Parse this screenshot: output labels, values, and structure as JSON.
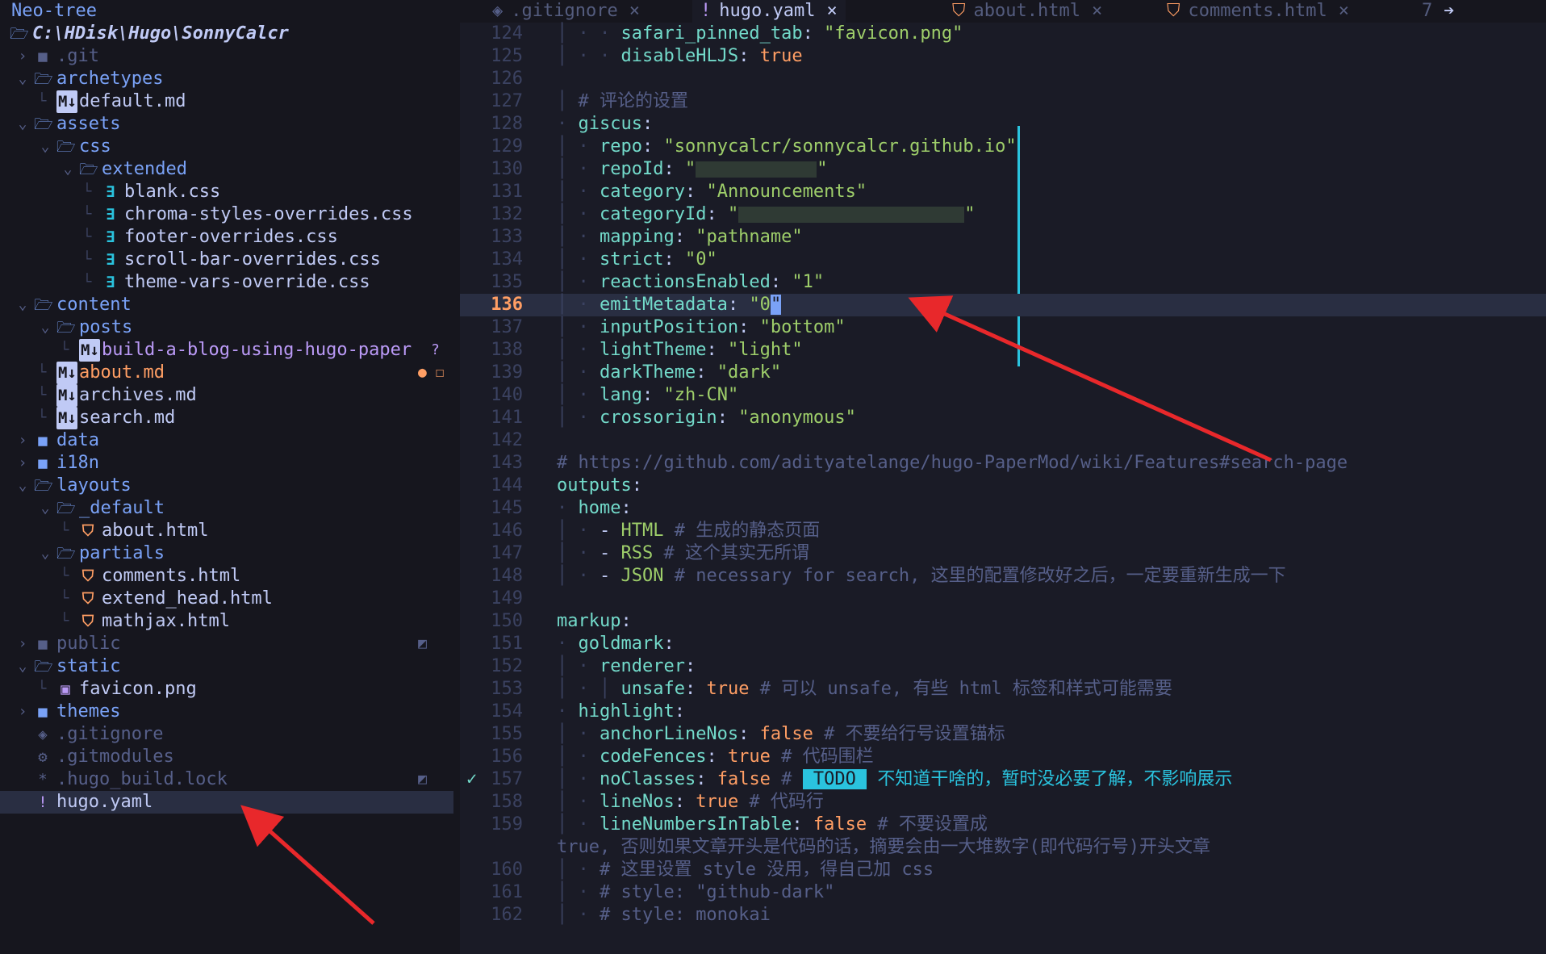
{
  "sidebar": {
    "title": "Neo-tree",
    "root": "C:\\HDisk\\Hugo\\SonnyCalcr",
    "items": [
      {
        "name": ".git",
        "kind": "dir-dim",
        "depth": 0,
        "open": false
      },
      {
        "name": "archetypes",
        "kind": "dir",
        "depth": 0,
        "open": true
      },
      {
        "name": "default.md",
        "kind": "md",
        "depth": 1
      },
      {
        "name": "assets",
        "kind": "dir",
        "depth": 0,
        "open": true
      },
      {
        "name": "css",
        "kind": "dir",
        "depth": 1,
        "open": true
      },
      {
        "name": "extended",
        "kind": "dir",
        "depth": 2,
        "open": true
      },
      {
        "name": "blank.css",
        "kind": "css",
        "depth": 3
      },
      {
        "name": "chroma-styles-overrides.css",
        "kind": "css",
        "depth": 3
      },
      {
        "name": "footer-overrides.css",
        "kind": "css",
        "depth": 3
      },
      {
        "name": "scroll-bar-overrides.css",
        "kind": "css",
        "depth": 3
      },
      {
        "name": "theme-vars-override.css",
        "kind": "css",
        "depth": 3
      },
      {
        "name": "content",
        "kind": "dir",
        "depth": 0,
        "open": true
      },
      {
        "name": "posts",
        "kind": "dir",
        "depth": 1,
        "open": true
      },
      {
        "name": "build-a-blog-using-hugo-paper",
        "kind": "md-untracked",
        "depth": 2,
        "mark": "?"
      },
      {
        "name": "about.md",
        "kind": "md-modified",
        "depth": 1,
        "mark": "● ☐"
      },
      {
        "name": "archives.md",
        "kind": "md",
        "depth": 1
      },
      {
        "name": "search.md",
        "kind": "md",
        "depth": 1
      },
      {
        "name": "data",
        "kind": "dir",
        "depth": 0,
        "open": false
      },
      {
        "name": "i18n",
        "kind": "dir",
        "depth": 0,
        "open": false
      },
      {
        "name": "layouts",
        "kind": "dir",
        "depth": 0,
        "open": true
      },
      {
        "name": "_default",
        "kind": "dir",
        "depth": 1,
        "open": true
      },
      {
        "name": "about.html",
        "kind": "html",
        "depth": 2
      },
      {
        "name": "partials",
        "kind": "dir",
        "depth": 1,
        "open": true
      },
      {
        "name": "comments.html",
        "kind": "html",
        "depth": 2
      },
      {
        "name": "extend_head.html",
        "kind": "html",
        "depth": 2
      },
      {
        "name": "mathjax.html",
        "kind": "html",
        "depth": 2
      },
      {
        "name": "public",
        "kind": "dir-dim",
        "depth": 0,
        "open": false,
        "mark": "◩"
      },
      {
        "name": "static",
        "kind": "dir",
        "depth": 0,
        "open": true
      },
      {
        "name": "favicon.png",
        "kind": "png",
        "depth": 1
      },
      {
        "name": "themes",
        "kind": "dir",
        "depth": 0,
        "open": false
      },
      {
        "name": ".gitignore",
        "kind": "git",
        "depth": 0
      },
      {
        "name": ".gitmodules",
        "kind": "gear",
        "depth": 0
      },
      {
        "name": ".hugo_build.lock",
        "kind": "lock",
        "depth": 0,
        "mark": "◩"
      },
      {
        "name": "hugo.yaml",
        "kind": "yaml",
        "depth": 0,
        "selected": true
      }
    ]
  },
  "tabs": [
    {
      "icon": "◈",
      "label": ".gitignore",
      "close": "×"
    },
    {
      "icon": "!",
      "label": "hugo.yaml",
      "close": "×",
      "active": true
    },
    {
      "icon": "⛉",
      "label": "about.html",
      "close": "×"
    },
    {
      "icon": "⛉",
      "label": "comments.html",
      "close": "×"
    },
    {
      "icon": "",
      "label": "7",
      "close": "➔"
    }
  ],
  "editor": {
    "current_line": "136",
    "lines": [
      {
        "n": "124",
        "segs": [
          [
            "ind",
            "│ · · "
          ],
          [
            "k",
            "safari_pinned_tab"
          ],
          [
            "p",
            ": "
          ],
          [
            "s",
            "\"favicon.png\""
          ]
        ]
      },
      {
        "n": "125",
        "segs": [
          [
            "ind",
            "│ · · "
          ],
          [
            "k",
            "disableHLJS"
          ],
          [
            "p",
            ": "
          ],
          [
            "b",
            "true"
          ]
        ]
      },
      {
        "n": "126",
        "segs": []
      },
      {
        "n": "127",
        "segs": [
          [
            "ind",
            "│ "
          ],
          [
            "c",
            "# 评论的设置"
          ]
        ]
      },
      {
        "n": "128",
        "segs": [
          [
            "ind",
            "· "
          ],
          [
            "k",
            "giscus"
          ],
          [
            "p",
            ":"
          ]
        ]
      },
      {
        "n": "129",
        "segs": [
          [
            "ind",
            "│ · "
          ],
          [
            "k",
            "repo"
          ],
          [
            "p",
            ": "
          ],
          [
            "s",
            "\"sonnycalcr/sonnycalcr.github.io\""
          ]
        ]
      },
      {
        "n": "130",
        "segs": [
          [
            "ind",
            "│ · "
          ],
          [
            "k",
            "repoId"
          ],
          [
            "p",
            ": "
          ],
          [
            "s",
            "\""
          ],
          [
            "redact",
            "150"
          ],
          [
            "s",
            "\""
          ]
        ]
      },
      {
        "n": "131",
        "segs": [
          [
            "ind",
            "│ · "
          ],
          [
            "k",
            "category"
          ],
          [
            "p",
            ": "
          ],
          [
            "s",
            "\"Announcements\""
          ]
        ]
      },
      {
        "n": "132",
        "segs": [
          [
            "ind",
            "│ · "
          ],
          [
            "k",
            "categoryId"
          ],
          [
            "p",
            ": "
          ],
          [
            "s",
            "\""
          ],
          [
            "redact",
            "280"
          ],
          [
            "s",
            "\""
          ]
        ]
      },
      {
        "n": "133",
        "segs": [
          [
            "ind",
            "│ · "
          ],
          [
            "k",
            "mapping"
          ],
          [
            "p",
            ": "
          ],
          [
            "s",
            "\"pathname\""
          ]
        ]
      },
      {
        "n": "134",
        "segs": [
          [
            "ind",
            "│ · "
          ],
          [
            "k",
            "strict"
          ],
          [
            "p",
            ": "
          ],
          [
            "s",
            "\"0\""
          ]
        ]
      },
      {
        "n": "135",
        "segs": [
          [
            "ind",
            "│ · "
          ],
          [
            "k",
            "reactionsEnabled"
          ],
          [
            "p",
            ": "
          ],
          [
            "s",
            "\"1\""
          ]
        ]
      },
      {
        "n": "136",
        "segs": [
          [
            "ind",
            "│ · "
          ],
          [
            "k",
            "emitMetadata"
          ],
          [
            "p",
            ": "
          ],
          [
            "s",
            "\"0"
          ],
          [
            "cursor",
            "\""
          ]
        ]
      },
      {
        "n": "137",
        "segs": [
          [
            "ind",
            "│ · "
          ],
          [
            "k",
            "inputPosition"
          ],
          [
            "p",
            ": "
          ],
          [
            "s",
            "\"bottom\""
          ]
        ]
      },
      {
        "n": "138",
        "segs": [
          [
            "ind",
            "│ · "
          ],
          [
            "k",
            "lightTheme"
          ],
          [
            "p",
            ": "
          ],
          [
            "s",
            "\"light\""
          ]
        ]
      },
      {
        "n": "139",
        "segs": [
          [
            "ind",
            "│ · "
          ],
          [
            "k",
            "darkTheme"
          ],
          [
            "p",
            ": "
          ],
          [
            "s",
            "\"dark\""
          ]
        ]
      },
      {
        "n": "140",
        "segs": [
          [
            "ind",
            "│ · "
          ],
          [
            "k",
            "lang"
          ],
          [
            "p",
            ": "
          ],
          [
            "s",
            "\"zh-CN\""
          ]
        ]
      },
      {
        "n": "141",
        "segs": [
          [
            "ind",
            "│ · "
          ],
          [
            "k",
            "crossorigin"
          ],
          [
            "p",
            ": "
          ],
          [
            "s",
            "\"anonymous\""
          ]
        ]
      },
      {
        "n": "142",
        "segs": []
      },
      {
        "n": "143",
        "segs": [
          [
            "c",
            "# https://github.com/adityatelange/hugo-PaperMod/wiki/Features#search-page"
          ]
        ]
      },
      {
        "n": "144",
        "segs": [
          [
            "k",
            "outputs"
          ],
          [
            "p",
            ":"
          ]
        ]
      },
      {
        "n": "145",
        "segs": [
          [
            "ind",
            "· "
          ],
          [
            "k",
            "home"
          ],
          [
            "p",
            ":"
          ]
        ]
      },
      {
        "n": "146",
        "segs": [
          [
            "ind",
            "│ · "
          ],
          [
            "p",
            "- "
          ],
          [
            "s",
            "HTML"
          ],
          [
            "c",
            " # 生成的静态页面"
          ]
        ]
      },
      {
        "n": "147",
        "segs": [
          [
            "ind",
            "│ · "
          ],
          [
            "p",
            "- "
          ],
          [
            "s",
            "RSS"
          ],
          [
            "c",
            " # 这个其实无所谓"
          ]
        ]
      },
      {
        "n": "148",
        "segs": [
          [
            "ind",
            "│ · "
          ],
          [
            "p",
            "- "
          ],
          [
            "s",
            "JSON"
          ],
          [
            "c",
            " # necessary for search, 这里的配置修改好之后，一定要重新生成一下"
          ]
        ]
      },
      {
        "n": "149",
        "segs": []
      },
      {
        "n": "150",
        "segs": [
          [
            "k",
            "markup"
          ],
          [
            "p",
            ":"
          ]
        ]
      },
      {
        "n": "151",
        "segs": [
          [
            "ind",
            "· "
          ],
          [
            "k",
            "goldmark"
          ],
          [
            "p",
            ":"
          ]
        ]
      },
      {
        "n": "152",
        "segs": [
          [
            "ind",
            "│ · "
          ],
          [
            "k",
            "renderer"
          ],
          [
            "p",
            ":"
          ]
        ]
      },
      {
        "n": "153",
        "segs": [
          [
            "ind",
            "│ · │ "
          ],
          [
            "k",
            "unsafe"
          ],
          [
            "p",
            ": "
          ],
          [
            "b",
            "true"
          ],
          [
            "c",
            " # 可以 unsafe, 有些 html 标签和样式可能需要"
          ]
        ]
      },
      {
        "n": "154",
        "segs": [
          [
            "ind",
            "· "
          ],
          [
            "k",
            "highlight"
          ],
          [
            "p",
            ":"
          ]
        ]
      },
      {
        "n": "155",
        "segs": [
          [
            "ind",
            "│ · "
          ],
          [
            "k",
            "anchorLineNos"
          ],
          [
            "p",
            ": "
          ],
          [
            "b",
            "false"
          ],
          [
            "c",
            " # 不要给行号设置锚标"
          ]
        ]
      },
      {
        "n": "156",
        "segs": [
          [
            "ind",
            "│ · "
          ],
          [
            "k",
            "codeFences"
          ],
          [
            "p",
            ": "
          ],
          [
            "b",
            "true"
          ],
          [
            "c",
            " # 代码围栏"
          ]
        ]
      },
      {
        "n": "157",
        "segs": [
          [
            "ind",
            "│ · "
          ],
          [
            "k",
            "noClasses"
          ],
          [
            "p",
            ": "
          ],
          [
            "b",
            "false"
          ],
          [
            "c",
            " # "
          ],
          [
            "todo",
            " TODO "
          ],
          [
            "todotext",
            " 不知道干啥的，暂时没必要了解，不影响展示"
          ]
        ],
        "sign": "✓"
      },
      {
        "n": "158",
        "segs": [
          [
            "ind",
            "│ · "
          ],
          [
            "k",
            "lineNos"
          ],
          [
            "p",
            ": "
          ],
          [
            "b",
            "true"
          ],
          [
            "c",
            " # 代码行"
          ]
        ]
      },
      {
        "n": "159",
        "segs": [
          [
            "ind",
            "│ · "
          ],
          [
            "k",
            "lineNumbersInTable"
          ],
          [
            "p",
            ": "
          ],
          [
            "b",
            "false"
          ],
          [
            "c",
            " # 不要设置成"
          ]
        ]
      },
      {
        "n": "",
        "segs": [
          [
            "c",
            "true, 否则如果文章开头是代码的话，摘要会由一大堆数字(即代码行号)开头文章"
          ]
        ],
        "wrap": true
      },
      {
        "n": "160",
        "segs": [
          [
            "ind",
            "│ · "
          ],
          [
            "c",
            "# 这里设置 style 没用，得自己加 css"
          ]
        ]
      },
      {
        "n": "161",
        "segs": [
          [
            "ind",
            "│ · "
          ],
          [
            "c",
            "# style: \"github-dark\""
          ]
        ]
      },
      {
        "n": "162",
        "segs": [
          [
            "ind",
            "│ · "
          ],
          [
            "c",
            "# style: monokai"
          ]
        ]
      }
    ]
  },
  "colors": {
    "background": "#1a1b26",
    "sidebar_bg": "#16161e",
    "key": "#73daca",
    "string": "#9ece6a",
    "boolean": "#ff9e64",
    "comment": "#565f89",
    "directory": "#7aa2f7",
    "annotation_arrow": "#e8282b"
  }
}
